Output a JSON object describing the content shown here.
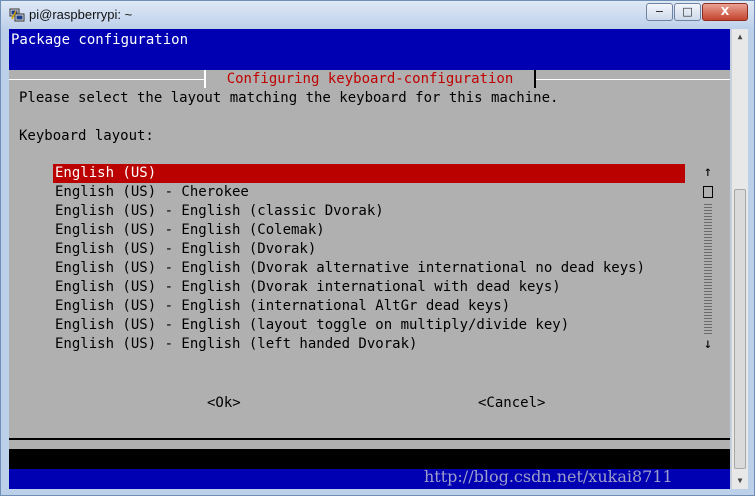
{
  "window": {
    "title": "pi@raspberrypi: ~",
    "min_label": "−",
    "max_label": "□",
    "close_label": "X"
  },
  "header": {
    "title": "Package configuration"
  },
  "dialog": {
    "title": "Configuring keyboard-configuration",
    "prompt": "Please select the layout matching the keyboard for this machine.",
    "layout_label": "Keyboard layout:",
    "items": [
      "English (US)",
      "English (US) - Cherokee",
      "English (US) - English (classic Dvorak)",
      "English (US) - English (Colemak)",
      "English (US) - English (Dvorak)",
      "English (US) - English (Dvorak alternative international no dead keys)",
      "English (US) - English (Dvorak international with dead keys)",
      "English (US) - English (international AltGr dead keys)",
      "English (US) - English (layout toggle on multiply/divide key)",
      "English (US) - English (left handed Dvorak)"
    ],
    "ok_label": "<Ok>",
    "cancel_label": "<Cancel>",
    "scroll_up": "↑",
    "scroll_down": "↓"
  },
  "watermark": "http://blog.csdn.net/xukai8711"
}
